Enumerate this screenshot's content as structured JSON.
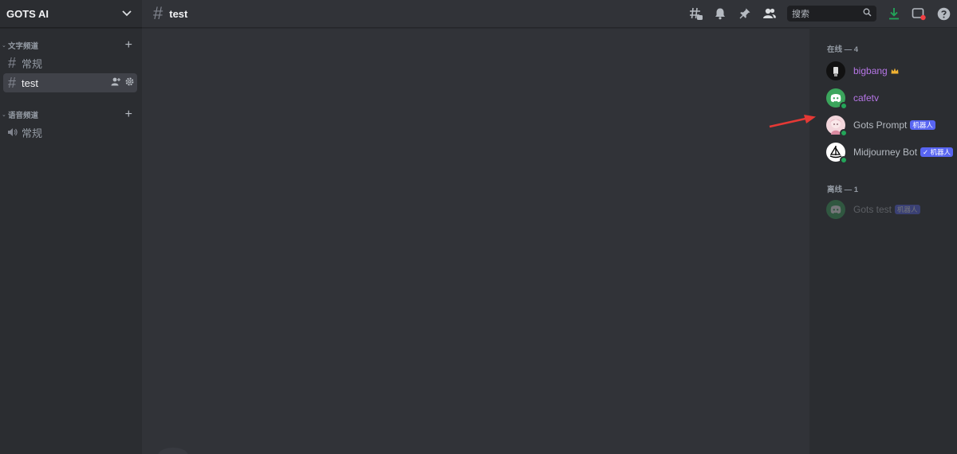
{
  "server": {
    "name": "GOTS AI"
  },
  "sidebar": {
    "text_category": "文字频道",
    "voice_category": "语音频道",
    "text_channels": [
      {
        "label": "常规",
        "active": false
      },
      {
        "label": "test",
        "active": true
      }
    ],
    "voice_channels": [
      {
        "label": "常规"
      }
    ]
  },
  "topbar": {
    "channel_name": "test",
    "search_placeholder": "搜索"
  },
  "members": {
    "online_label": "在线 — 4",
    "offline_label": "离线 — 1",
    "online": [
      {
        "name": "bigbang",
        "color": "#b676e6",
        "badge": "",
        "crown": true,
        "avatar": "dark"
      },
      {
        "name": "cafetv",
        "color": "#b676e6",
        "badge": "",
        "crown": false,
        "avatar": "discord-green"
      },
      {
        "name": "Gots Prompt",
        "color": "#b5bac1",
        "badge": "机器人",
        "crown": false,
        "avatar": "anime"
      },
      {
        "name": "Midjourney Bot",
        "color": "#b5bac1",
        "badge": "✓ 机器人",
        "crown": false,
        "avatar": "boat"
      }
    ],
    "offline": [
      {
        "name": "Gots test",
        "color": "#b5bac1",
        "badge": "机器人",
        "avatar": "discord-green"
      }
    ]
  },
  "colors": {
    "accent": "#5865f2",
    "online_status": "#23a559",
    "arrow": "#e53935"
  }
}
